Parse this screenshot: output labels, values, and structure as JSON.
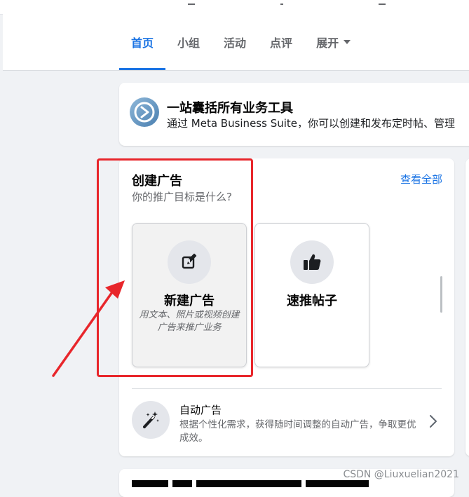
{
  "tabs": [
    {
      "label": "首页",
      "active": true
    },
    {
      "label": "小组",
      "active": false
    },
    {
      "label": "活动",
      "active": false
    },
    {
      "label": "点评",
      "active": false
    },
    {
      "label": "展开",
      "active": false
    }
  ],
  "business_suite": {
    "title": "一站囊括所有业务工具",
    "description": "通过 Meta Business Suite，你可以创建和发布定时帖、管理"
  },
  "create_ad": {
    "title": "创建广告",
    "subtitle": "你的推广目标是什么?",
    "see_all": "查看全部",
    "options": [
      {
        "title": "新建广告",
        "description": "用文本、照片或视频创建广告来推广业务",
        "icon": "edit-icon"
      },
      {
        "title": "速推帖子",
        "description": "",
        "icon": "thumbs-up-icon"
      }
    ],
    "auto_ad": {
      "title": "自动广告",
      "description": "根据个性化需求，获得随时间调整的自动广告，争取更优成效。",
      "icon": "magic-wand-icon"
    }
  },
  "watermark": "CSDN @Liuxuelian2021",
  "colors": {
    "accent": "#1b74e4",
    "annotation_red": "#e8262b",
    "background": "#f0f2f5"
  }
}
